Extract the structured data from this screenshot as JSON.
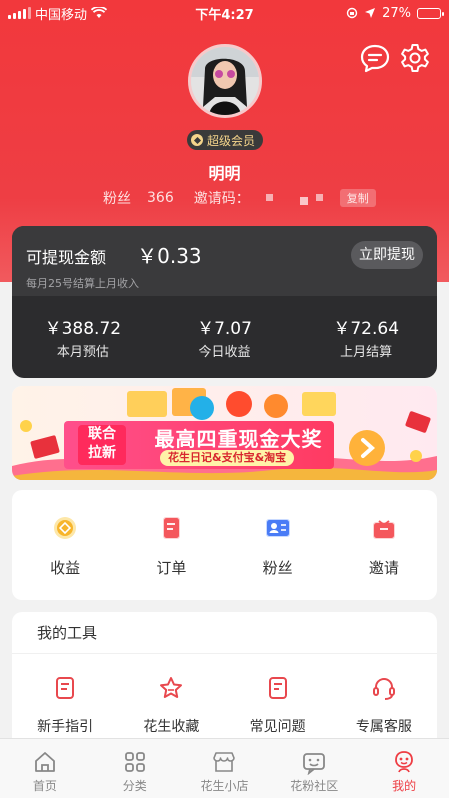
{
  "status_bar": {
    "carrier": "中国移动",
    "time": "下午4:27",
    "battery": "27%",
    "battery_level": 0.27
  },
  "profile": {
    "vip_label": "超级会员",
    "username": "明明",
    "fans_label": "粉丝",
    "fans_count": "366",
    "invite_label": "邀请码：",
    "copy_label": "复制"
  },
  "wallet": {
    "withdrawable_label": "可提现金额",
    "withdrawable_amount": "￥0.33",
    "note": "每月25号结算上月收入",
    "withdraw_button": "立即提现",
    "stats": [
      {
        "value": "￥388.72",
        "label": "本月预估"
      },
      {
        "value": "￥7.07",
        "label": "今日收益"
      },
      {
        "value": "￥72.64",
        "label": "上月结算"
      }
    ]
  },
  "banner": {
    "tag_line1": "联合",
    "tag_line2": "拉新",
    "headline": "最高四重现金大奖",
    "sub": "花生日记&支付宝&淘宝"
  },
  "quick_menu": [
    {
      "label": "收益",
      "icon": "income-icon"
    },
    {
      "label": "订单",
      "icon": "order-icon"
    },
    {
      "label": "粉丝",
      "icon": "fans-card-icon"
    },
    {
      "label": "邀请",
      "icon": "invite-gift-icon"
    }
  ],
  "tools": {
    "title": "我的工具",
    "items": [
      {
        "label": "新手指引",
        "icon": "guide-icon"
      },
      {
        "label": "花生收藏",
        "icon": "favorite-star-icon"
      },
      {
        "label": "常见问题",
        "icon": "faq-icon"
      },
      {
        "label": "专属客服",
        "icon": "customer-service-icon"
      }
    ]
  },
  "tabbar": [
    {
      "label": "首页",
      "icon": "home-icon",
      "active": false
    },
    {
      "label": "分类",
      "icon": "category-icon",
      "active": false
    },
    {
      "label": "花生小店",
      "icon": "shop-icon",
      "active": false
    },
    {
      "label": "花粉社区",
      "icon": "community-icon",
      "active": false
    },
    {
      "label": "我的",
      "icon": "profile-icon",
      "active": true
    }
  ],
  "colors": {
    "brand_red": "#ee3e44",
    "vip_gold": "#f4d48b",
    "wallet_dark": "#2c2c2e"
  }
}
